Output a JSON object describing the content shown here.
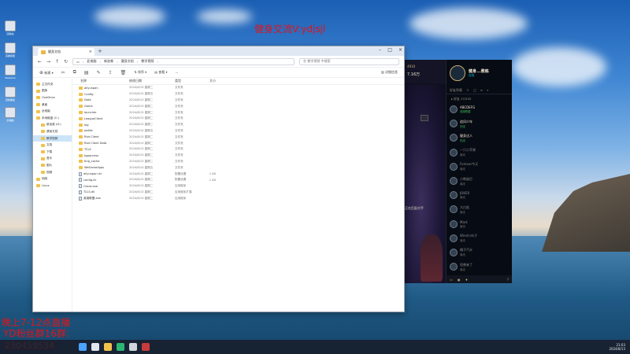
{
  "overlays": {
    "top_text": "健身交流V:ydjsjl",
    "bottom_line1": "晚上7-12点直播",
    "bottom_line2": "YD粉丝群16群:",
    "bottom_line3": "230459534"
  },
  "explorer": {
    "tab_title": "健身文档",
    "address_parts": [
      "此电脑",
      "新加卷",
      "健身文档",
      "教学视频"
    ],
    "search_placeholder": "在 教学视频 中搜索",
    "toolbar": {
      "new": "新建",
      "sort": "排序",
      "view": "查看",
      "details": "详细信息"
    },
    "nav_items": [
      {
        "label": "主文件夹",
        "level": 0
      },
      {
        "label": "图库",
        "level": 0
      },
      {
        "label": "OneDrive",
        "level": 0
      },
      {
        "label": "桌面",
        "level": 0
      },
      {
        "label": "此电脑",
        "level": 0
      },
      {
        "label": "本地磁盘 (C:)",
        "level": 0
      },
      {
        "label": "新加卷 (D:)",
        "level": 1
      },
      {
        "label": "健身文档",
        "level": 1
      },
      {
        "label": "教学视频",
        "level": 1
      },
      {
        "label": "文档",
        "level": 1
      },
      {
        "label": "下载",
        "level": 1
      },
      {
        "label": "音乐",
        "level": 1
      },
      {
        "label": "图片",
        "level": 1
      },
      {
        "label": "视频",
        "level": 1
      },
      {
        "label": "网络",
        "level": 0
      },
      {
        "label": "Linux",
        "level": 0
      }
    ],
    "columns": {
      "name": "名称",
      "date": "修改日期",
      "type": "类型",
      "size": "大小"
    },
    "files": [
      {
        "name": "aliyunpan",
        "date": "2024/8/13 星期二",
        "type": "文件夹",
        "size": "",
        "kind": "folder"
      },
      {
        "name": "Config",
        "date": "2024/6/14 星期五",
        "type": "文件夹",
        "size": "",
        "kind": "folder"
      },
      {
        "name": "Data",
        "date": "2024/8/13 星期二",
        "type": "文件夹",
        "size": "",
        "kind": "folder"
      },
      {
        "name": "Game",
        "date": "2024/8/13 星期二",
        "type": "文件夹",
        "size": "",
        "kind": "folder"
      },
      {
        "name": "launcher",
        "date": "2024/8/13 星期二",
        "type": "文件夹",
        "size": "",
        "kind": "folder"
      },
      {
        "name": "LeagueClient",
        "date": "2024/8/13 星期二",
        "type": "文件夹",
        "size": "",
        "kind": "folder"
      },
      {
        "name": "log",
        "date": "2024/8/13 星期二",
        "type": "文件夹",
        "size": "",
        "kind": "folder"
      },
      {
        "name": "pidlist",
        "date": "2024/6/14 星期五",
        "type": "文件夹",
        "size": "",
        "kind": "folder"
      },
      {
        "name": "Riot Client",
        "date": "2024/8/13 星期二",
        "type": "文件夹",
        "size": "",
        "kind": "folder"
      },
      {
        "name": "Riot Client Data",
        "date": "2024/8/13 星期二",
        "type": "文件夹",
        "size": "",
        "kind": "folder"
      },
      {
        "name": "TCLS",
        "date": "2024/8/13 星期二",
        "type": "文件夹",
        "size": "",
        "kind": "folder"
      },
      {
        "name": "tgpaccess",
        "date": "2024/8/13 星期二",
        "type": "文件夹",
        "size": "",
        "kind": "folder"
      },
      {
        "name": "ting_cache",
        "date": "2024/8/13 星期二",
        "type": "文件夹",
        "size": "",
        "kind": "folder"
      },
      {
        "name": "WeGameApps",
        "date": "2024/6/14 星期五",
        "type": "文件夹",
        "size": "",
        "kind": "folder"
      },
      {
        "name": "aliyunpan.ini",
        "date": "2024/8/13 星期二",
        "type": "配置设置",
        "size": "1 KB",
        "kind": "file"
      },
      {
        "name": "config.ini",
        "date": "2024/8/13 星期二",
        "type": "配置设置",
        "size": "1 KB",
        "kind": "file"
      },
      {
        "name": "Client.exe",
        "date": "2024/8/13 星期二",
        "type": "应用程序",
        "size": "",
        "kind": "file"
      },
      {
        "name": "TCLS.dll",
        "date": "2024/8/13 星期二",
        "type": "应用程序扩展",
        "size": "",
        "kind": "file"
      },
      {
        "name": "英雄联盟.exe",
        "date": "2024/8/13 星期二",
        "type": "应用程序",
        "size": "",
        "kind": "file"
      }
    ]
  },
  "game": {
    "top_value": "4910",
    "top_sub": "7.16万",
    "message": "正在匹配对手",
    "profile_name": "健身...教练",
    "profile_status": "在线",
    "friends_title": "好友列表",
    "group": "▸ 好友 17/255",
    "friends": [
      {
        "name": "ABCDEFG",
        "status": "英雄联盟",
        "online": true
      },
      {
        "name": "追风少年",
        "status": "在线",
        "online": true
      },
      {
        "name": "健身达人",
        "status": "在线",
        "online": true
      },
      {
        "name": "一只小苹果",
        "status": "离线",
        "online": false
      },
      {
        "name": "Forever今天",
        "status": "离线",
        "online": false
      },
      {
        "name": "小熊维尼",
        "status": "离线",
        "online": false
      },
      {
        "name": "JOKER",
        "status": "离线",
        "online": false
      },
      {
        "name": "大白鲨",
        "status": "离线",
        "online": false
      },
      {
        "name": "Mark",
        "status": "离线",
        "online": false
      },
      {
        "name": "Wind小伙子",
        "status": "离线",
        "online": false
      },
      {
        "name": "橘子汽水",
        "status": "离线",
        "online": false
      },
      {
        "name": "怪兽来了",
        "status": "离线",
        "online": false
      }
    ]
  },
  "taskbar": {
    "time": "21:03",
    "date": "2024/8/13",
    "icons": [
      "windows-start",
      "search",
      "file-explorer",
      "edge-browser",
      "chat",
      "game-client"
    ]
  },
  "desktop": {
    "icons": [
      "回收站",
      "英雄联盟",
      "WeGame",
      "控制面板",
      "此电脑"
    ]
  }
}
